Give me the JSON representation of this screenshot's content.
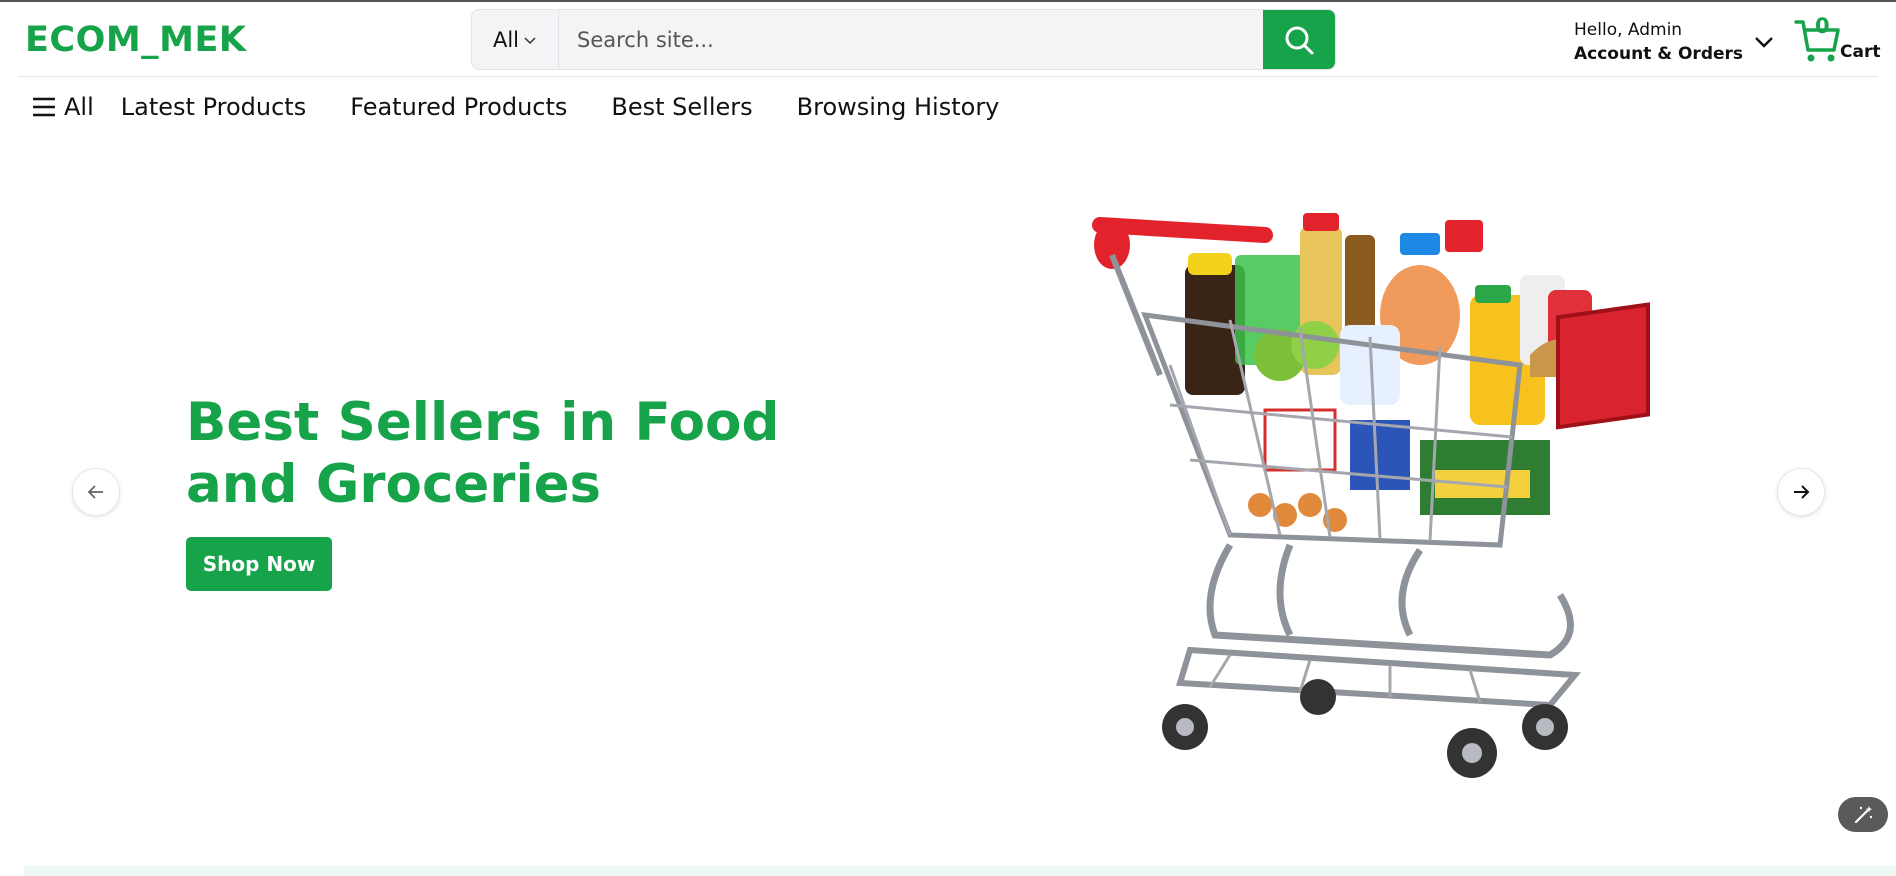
{
  "header": {
    "logo": "ECOM_MEK",
    "search": {
      "category": "All",
      "placeholder": "Search site..."
    },
    "account": {
      "greeting": "Hello, Admin",
      "label": "Account & Orders"
    },
    "cart": {
      "count": "0",
      "label": "Cart"
    }
  },
  "nav": {
    "all_label": "All",
    "links": [
      "Latest Products",
      "Featured Products",
      "Best Sellers",
      "Browsing History"
    ]
  },
  "hero": {
    "title": "Best Sellers in Food and Groceries",
    "button": "Shop Now"
  },
  "icons": {
    "search": "search-icon",
    "chevron": "chevron-down-icon",
    "cart": "cart-icon",
    "menu": "hamburger-menu-icon",
    "prev": "arrow-left-icon",
    "next": "arrow-right-icon",
    "magic": "magic-wand-icon"
  },
  "colors": {
    "brand": "#16a34a",
    "text": "#111111"
  }
}
